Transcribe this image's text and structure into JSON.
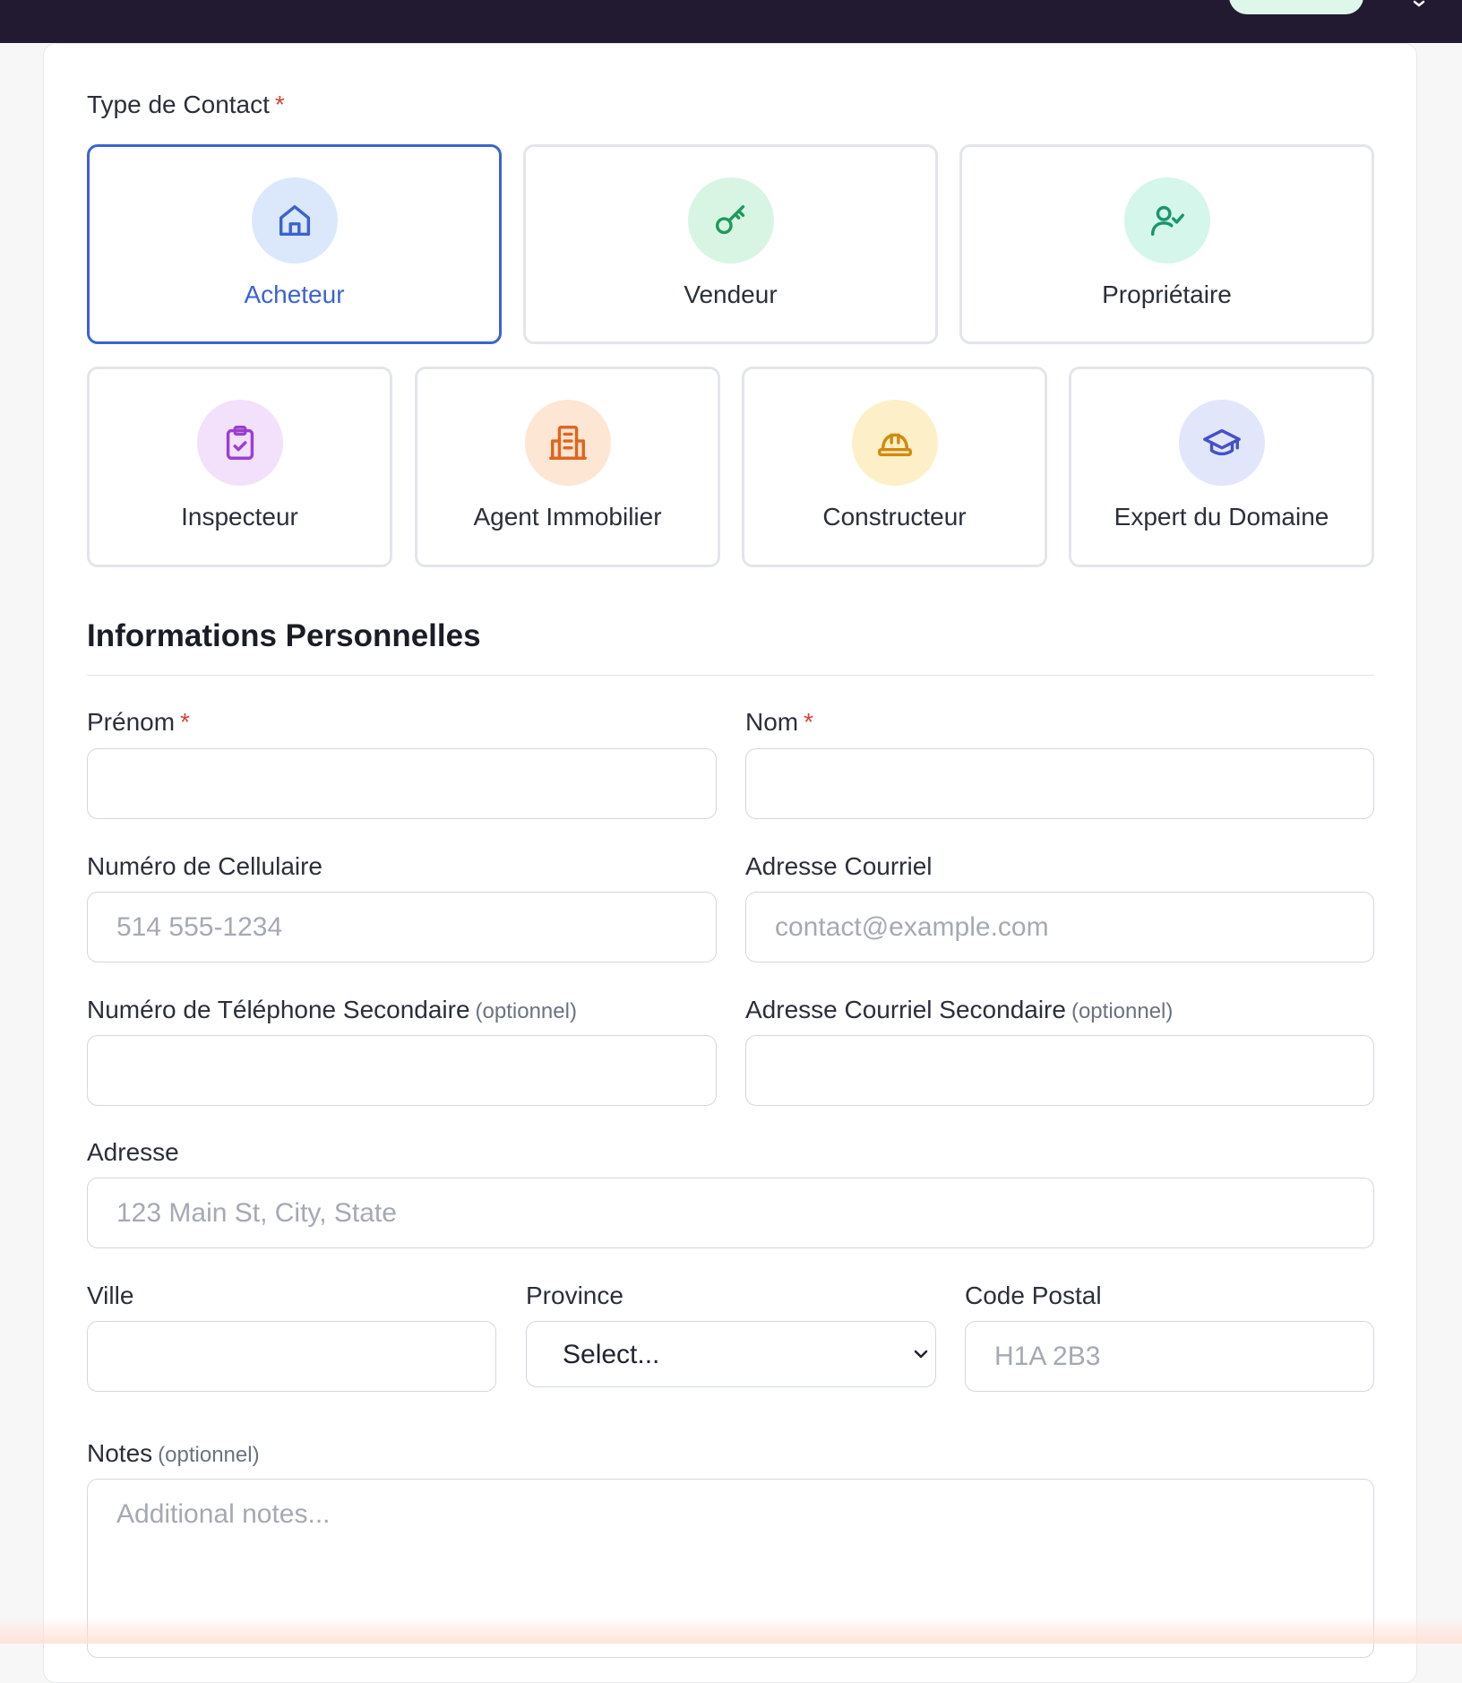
{
  "colors": {
    "topbar": "#221a30",
    "selected_border": "#3b63d1",
    "required_star": "#d9413a"
  },
  "contact_type": {
    "label": "Type de Contact",
    "required_mark": "*",
    "options": [
      {
        "label": "Acheteur",
        "icon": "home-icon",
        "selected": true,
        "circle": "#dbe8fb",
        "stroke": "#3b63d1"
      },
      {
        "label": "Vendeur",
        "icon": "key-icon",
        "selected": false,
        "circle": "#d8f5e4",
        "stroke": "#1f9a5a"
      },
      {
        "label": "Propriétaire",
        "icon": "user-check-icon",
        "selected": false,
        "circle": "#d5f6ea",
        "stroke": "#18966d"
      },
      {
        "label": "Inspecteur",
        "icon": "clipboard-check-icon",
        "selected": false,
        "circle": "#f3e1fb",
        "stroke": "#9b3fd1"
      },
      {
        "label": "Agent Immobilier",
        "icon": "building-icon",
        "selected": false,
        "circle": "#fde6d3",
        "stroke": "#e0651f"
      },
      {
        "label": "Constructeur",
        "icon": "hard-hat-icon",
        "selected": false,
        "circle": "#fdf0c8",
        "stroke": "#d08a10"
      },
      {
        "label": "Expert du Domaine",
        "icon": "graduation-cap-icon",
        "selected": false,
        "circle": "#e2e6fb",
        "stroke": "#4452c8"
      }
    ]
  },
  "personal_info": {
    "title": "Informations Personnelles",
    "first_name": {
      "label": "Prénom",
      "required_mark": "*",
      "value": "",
      "placeholder": ""
    },
    "last_name": {
      "label": "Nom",
      "required_mark": "*",
      "value": "",
      "placeholder": ""
    },
    "cell_phone": {
      "label": "Numéro de Cellulaire",
      "value": "",
      "placeholder": "514 555-1234"
    },
    "email": {
      "label": "Adresse Courriel",
      "value": "",
      "placeholder": "contact@example.com"
    },
    "secondary_phone": {
      "label": "Numéro de Téléphone Secondaire",
      "optional": "(optionnel)",
      "value": "",
      "placeholder": ""
    },
    "secondary_email": {
      "label": "Adresse Courriel Secondaire",
      "optional": "(optionnel)",
      "value": "",
      "placeholder": ""
    },
    "address": {
      "label": "Adresse",
      "value": "",
      "placeholder": "123 Main St, City, State"
    },
    "city": {
      "label": "Ville",
      "value": "",
      "placeholder": ""
    },
    "province": {
      "label": "Province",
      "selected": "Select..."
    },
    "postal_code": {
      "label": "Code Postal",
      "value": "",
      "placeholder": "H1A 2B3"
    },
    "notes": {
      "label": "Notes",
      "optional": "(optionnel)",
      "value": "",
      "placeholder": "Additional notes..."
    }
  }
}
